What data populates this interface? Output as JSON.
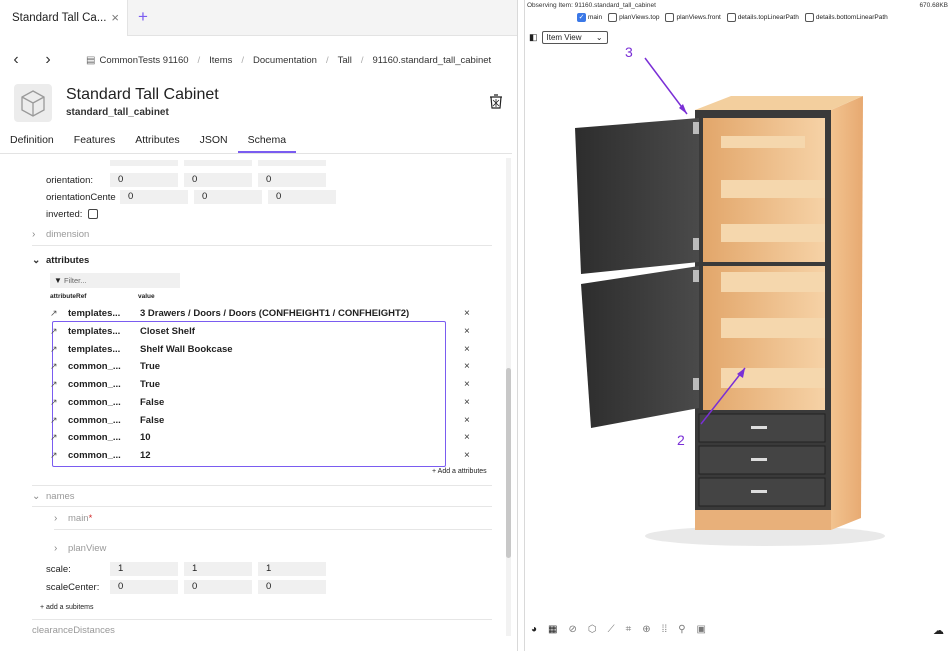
{
  "tab": {
    "title": "Standard Tall Ca...",
    "close": "×",
    "new": "+"
  },
  "breadcrumb": [
    "CommonTests 91160",
    "Items",
    "Documentation",
    "Tall",
    "91160.standard_tall_cabinet"
  ],
  "item": {
    "title": "Standard Tall Cabinet",
    "subtitle": "standard_tall_cabinet"
  },
  "tabs": [
    "Definition",
    "Features",
    "Attributes",
    "JSON",
    "Schema"
  ],
  "active_tab": "Schema",
  "schema": {
    "orientation_label": "orientation:",
    "orientation": [
      "0",
      "0",
      "0"
    ],
    "orientationCenter_label": "orientationCente",
    "orientationCenter": [
      "0",
      "0",
      "0"
    ],
    "inverted_label": "inverted:",
    "dimension_label": "dimension",
    "attributes_label": "attributes",
    "filter_placeholder": "Filter...",
    "col_ref": "attributeRef",
    "col_value": "value",
    "attributes": [
      {
        "ref": "templates...",
        "value": "3 Drawers / Doors / Doors (CONFHEIGHT1 / CONFHEIGHT2)"
      },
      {
        "ref": "templates...",
        "value": "Closet Shelf"
      },
      {
        "ref": "templates...",
        "value": "Shelf Wall Bookcase"
      },
      {
        "ref": "common_...",
        "value": "True"
      },
      {
        "ref": "common_...",
        "value": "True"
      },
      {
        "ref": "common_...",
        "value": "False"
      },
      {
        "ref": "common_...",
        "value": "False"
      },
      {
        "ref": "common_...",
        "value": "10"
      },
      {
        "ref": "common_...",
        "value": "12"
      }
    ],
    "add_attributes": "+ Add a attributes",
    "names_label": "names",
    "main_label": "main",
    "required_marker": "*",
    "planView_label": "planView",
    "scale_label": "scale:",
    "scale": [
      "1",
      "1",
      "1"
    ],
    "scaleCenter_label": "scaleCenter:",
    "scaleCenter": [
      "0",
      "0",
      "0"
    ],
    "add_subitems": "+ add a subitems",
    "clearance_label": "clearanceDistances"
  },
  "viewer": {
    "observing": "Observing Item: 91160.standard_tall_cabinet",
    "size": "670.68KB",
    "views": [
      {
        "label": "main",
        "checked": true
      },
      {
        "label": "planViews.top",
        "checked": false
      },
      {
        "label": "planViews.front",
        "checked": false
      },
      {
        "label": "details.topLinearPath",
        "checked": false
      },
      {
        "label": "details.bottomLinearPath",
        "checked": false
      }
    ],
    "view_mode": "Item View",
    "annotation_3": "3",
    "annotation_2": "2",
    "accent": "#7a2fd6"
  }
}
